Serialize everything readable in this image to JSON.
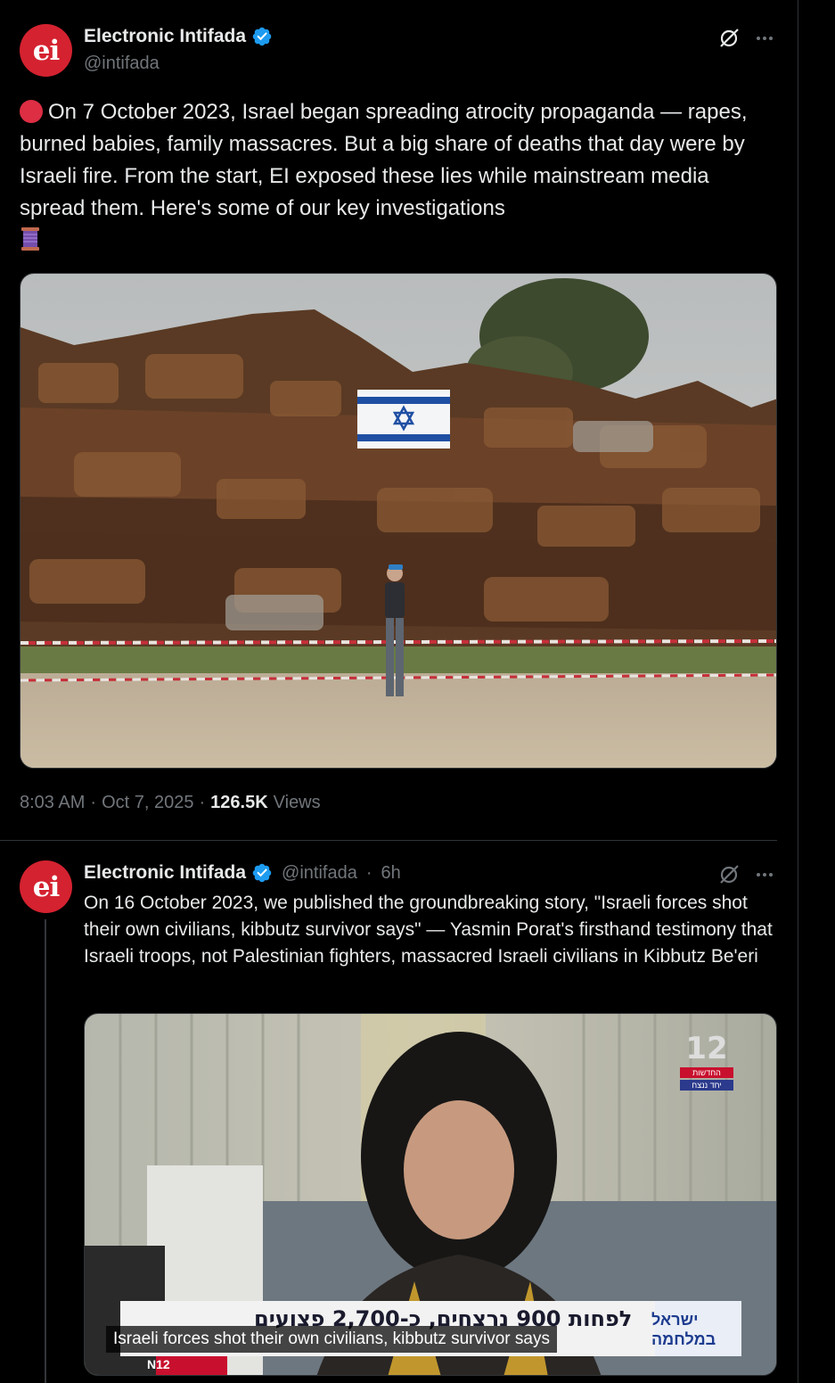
{
  "main_tweet": {
    "avatar_text": "ei",
    "display_name": "Electronic Intifada",
    "handle": "@intifada",
    "text": "On 7 October 2023, Israel began spreading atrocity propaganda — rapes, burned babies, family massacres. But a big share of deaths that day were by Israeli fire. From the start, EI exposed these lies while mainstream media spread them. Here's some of our key investigations",
    "time": "8:03 AM",
    "separator": "·",
    "date": "Oct 7, 2025",
    "views_count": "126.5K",
    "views_label": "Views"
  },
  "reply_tweet": {
    "avatar_text": "ei",
    "display_name": "Electronic Intifada",
    "handle": "@intifada",
    "separator": "·",
    "age": "6h",
    "text": "On 16 October 2023, we published the groundbreaking story, \"Israeli forces shot their own civilians, kibbutz survivor says\" — Yasmin Porat's firsthand testimony that Israeli troops, not Palestinian fighters, massacred Israeli civilians in Kibbutz Be'eri",
    "video": {
      "caption": "Israeli forces shot their own civilians, kibbutz survivor says",
      "banner": "לפחות 900 נרצחים, כ-2,700 פצועים",
      "channel_number": "12",
      "channel_tag_1": "החדשות",
      "channel_tag_2": "יחד ננצח",
      "war_logo_line1": "ישראל",
      "war_logo_line2": "במלחמה",
      "corner_logo": "N12"
    }
  },
  "icons": {
    "verified": "verified-badge-icon",
    "grok": "grok-icon",
    "more": "more-icon",
    "red_circle": "red-circle-emoji",
    "thread": "thread-spool-emoji"
  },
  "colors": {
    "background": "#000000",
    "text_primary": "#e7e9ea",
    "text_secondary": "#71767b",
    "verified_blue": "#1d9bf0",
    "avatar_red": "#d42230",
    "border": "#2f3336"
  }
}
